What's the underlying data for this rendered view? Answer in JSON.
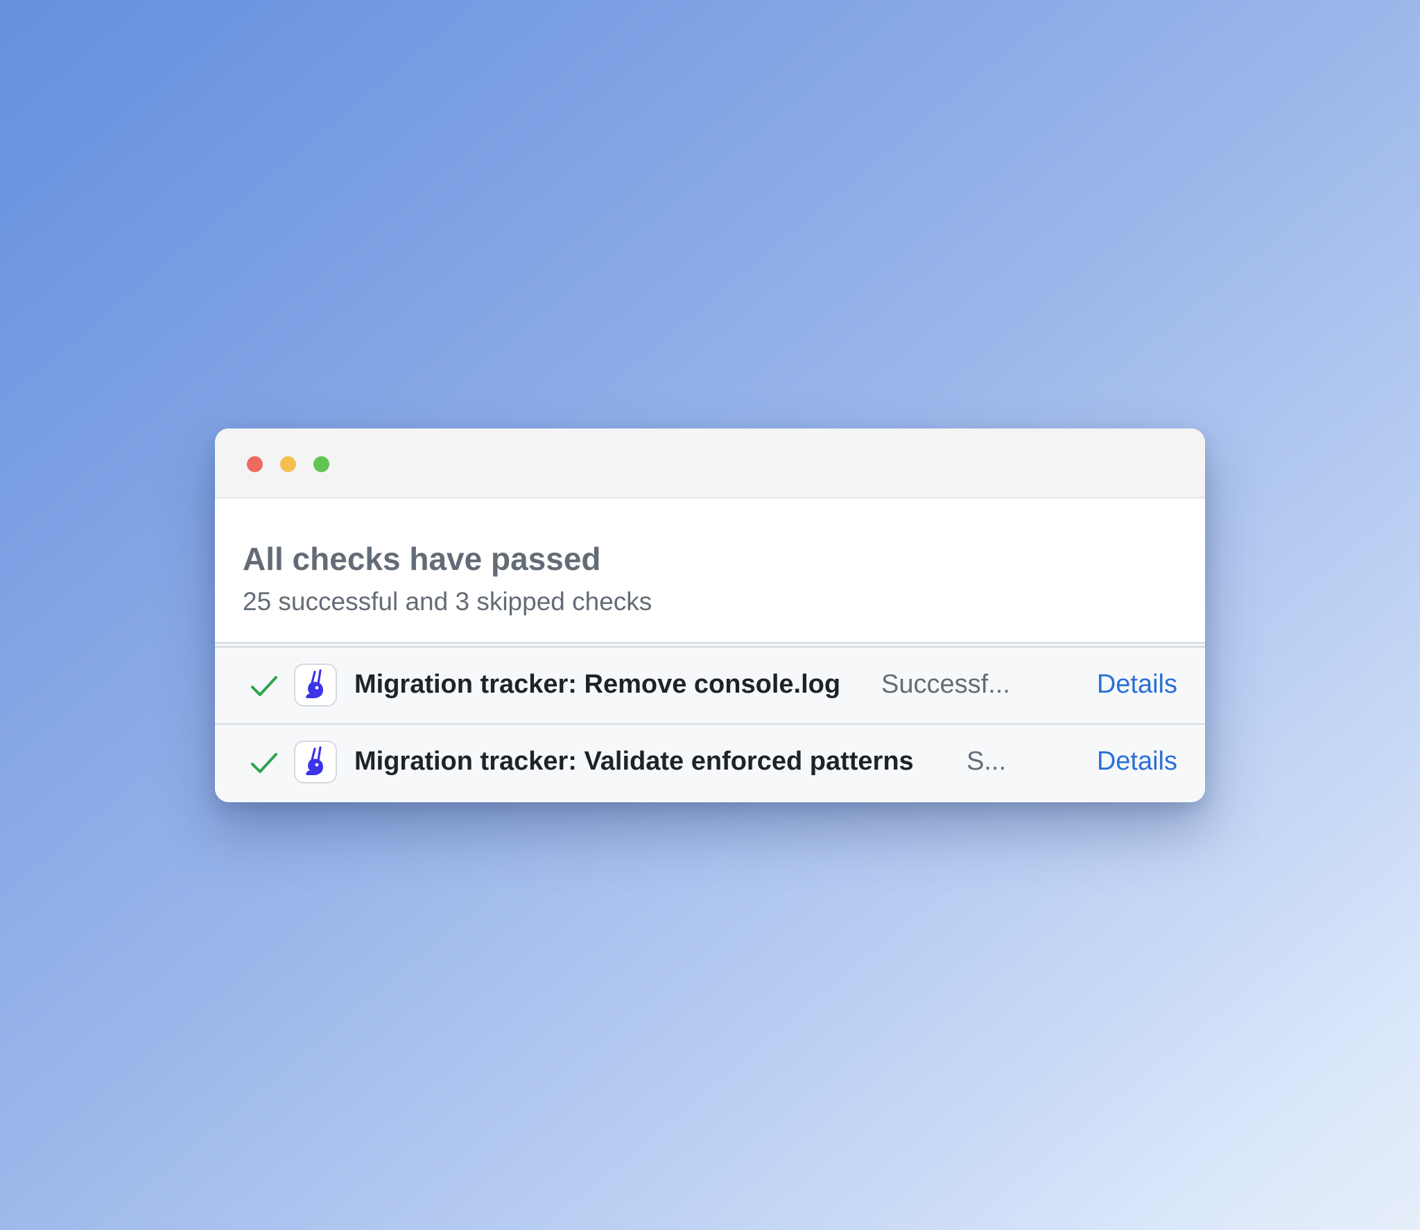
{
  "summary": {
    "title": "All checks have passed",
    "subtitle": "25 successful and 3 skipped checks"
  },
  "checks": [
    {
      "name": "Migration tracker: Remove console.log",
      "status": "Successf...",
      "details_label": "Details",
      "result_icon": "check-icon",
      "app_icon": "migration-tracker-app-icon"
    },
    {
      "name": "Migration tracker: Validate enforced patterns",
      "status": "S...",
      "details_label": "Details",
      "result_icon": "check-icon",
      "app_icon": "migration-tracker-app-icon"
    }
  ],
  "colors": {
    "success_green": "#2da44e",
    "link_blue": "#2a6fd6",
    "app_icon_blue": "#3b34e8",
    "traffic_red": "#ec6a5e",
    "traffic_yellow": "#f4bf4f",
    "traffic_green": "#61c554"
  }
}
